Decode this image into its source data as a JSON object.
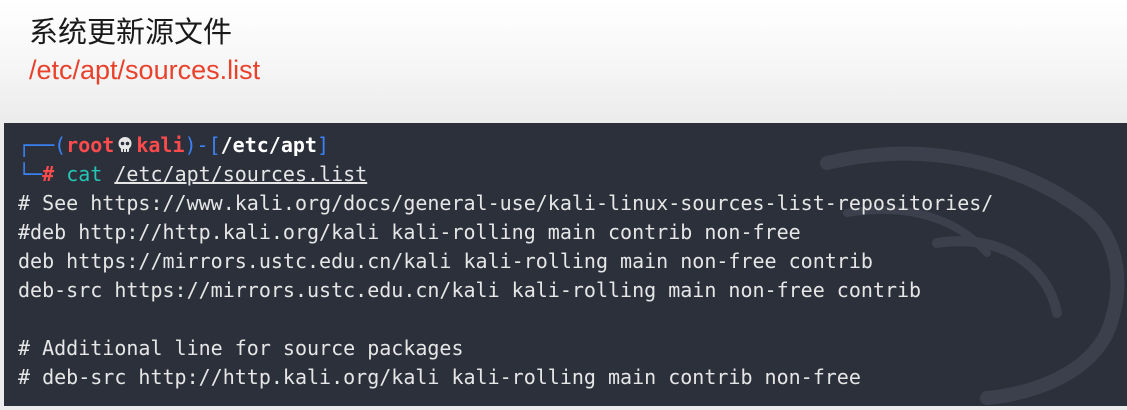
{
  "slide": {
    "title": "系统更新源文件",
    "subtitle": "/etc/apt/sources.list"
  },
  "terminal": {
    "prompt": {
      "frame_top_left": "┌──(",
      "user": "root",
      "skull_icon": "skull-icon",
      "host": "kali",
      "frame_mid": ")-[",
      "cwd": "/etc/apt",
      "frame_close": "]",
      "frame_bottom": "└─",
      "symbol": "#",
      "command": "cat",
      "argument": "/etc/apt/sources.list"
    },
    "output": [
      "# See https://www.kali.org/docs/general-use/kali-linux-sources-list-repositories/",
      "#deb http://http.kali.org/kali kali-rolling main contrib non-free",
      "deb https://mirrors.ustc.edu.cn/kali kali-rolling main non-free contrib",
      "deb-src https://mirrors.ustc.edu.cn/kali kali-rolling main non-free contrib",
      "",
      "# Additional line for source packages",
      "# deb-src http://http.kali.org/kali kali-rolling main contrib non-free"
    ]
  },
  "colors": {
    "subtitle": "#e8412c",
    "terminal_bg": "#2b303b",
    "prompt_frame": "#3b82f6",
    "prompt_user": "#ff4b4b",
    "command": "#26c6b6"
  }
}
